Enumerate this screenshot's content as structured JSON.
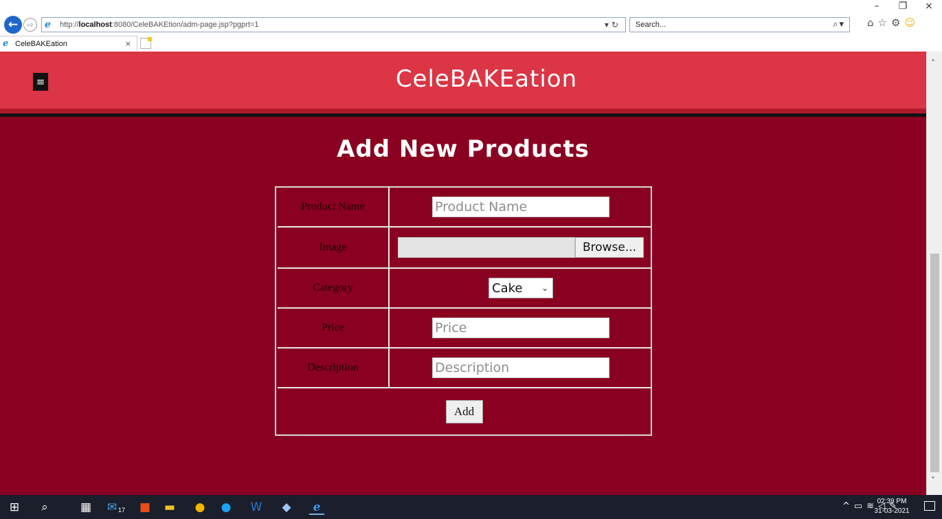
{
  "browser": {
    "window_controls": {
      "minimize": "–",
      "restore": "❐",
      "close": "×"
    },
    "url_prefix": "http://",
    "url_host": "localhost",
    "url_rest": ":8080/CeleBAKEtion/adm-page.jsp?pgprt=1",
    "search_placeholder": "Search...",
    "tab_title": "CeleBAKEation",
    "icons": {
      "back": "back-arrow-icon",
      "forward": "forward-arrow-icon",
      "refresh": "refresh-icon",
      "search": "search-icon",
      "home": "home-icon",
      "favorites": "star-icon",
      "settings": "gear-icon",
      "feedback": "smiley-icon"
    }
  },
  "site": {
    "brand": "CeleBAKEation",
    "menu_icon": "hamburger-menu-icon",
    "page_title": "Add New Products",
    "colors": {
      "header": "#dc3545",
      "background": "#8a0020",
      "label_text": "#1e0006"
    }
  },
  "form": {
    "rows": [
      {
        "label": "Product Name",
        "type": "text",
        "placeholder": "Product Name"
      },
      {
        "label": "Image",
        "type": "file",
        "button": "Browse..."
      },
      {
        "label": "Category",
        "type": "select",
        "selected": "Cake"
      },
      {
        "label": "Price",
        "type": "text",
        "placeholder": "Price"
      },
      {
        "label": "Description",
        "type": "text",
        "placeholder": "Description"
      }
    ],
    "submit_label": "Add"
  },
  "taskbar": {
    "mail_badge": "17",
    "time": "02:39 PM",
    "date": "31-03-2021"
  }
}
